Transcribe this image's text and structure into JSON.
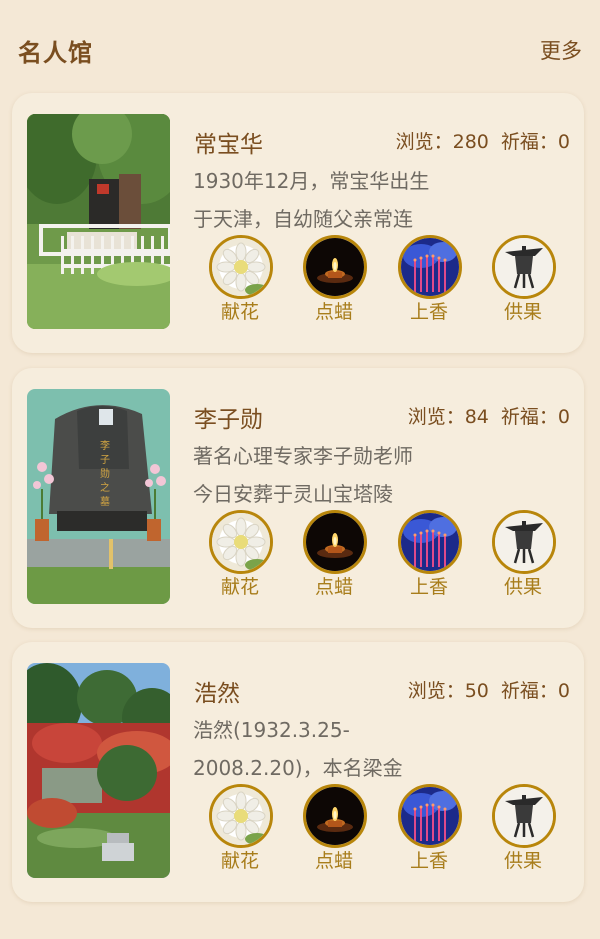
{
  "header": {
    "title": "名人馆",
    "more": "更多"
  },
  "actions": [
    {
      "label": "献花",
      "icon": "chrysanthemum-icon"
    },
    {
      "label": "点蜡",
      "icon": "candle-icon"
    },
    {
      "label": "上香",
      "icon": "incense-icon"
    },
    {
      "label": "供果",
      "icon": "bronze-vessel-icon"
    }
  ],
  "stats_labels": {
    "views": "浏览：",
    "blessings": "祈福："
  },
  "cards": [
    {
      "name": "常宝华",
      "views": "280",
      "blessings": "0",
      "line1": "1930年12月，常宝华出生",
      "line2": "于天津，自幼随父亲常连"
    },
    {
      "name": "李子勋",
      "views": "84",
      "blessings": "0",
      "line1": "著名心理专家李子勋老师",
      "line2": "今日安葬于灵山宝塔陵"
    },
    {
      "name": "浩然",
      "views": "50",
      "blessings": "0",
      "line1": "浩然(1932.3.25-",
      "line2": "2008.2.20)，本名梁金"
    }
  ],
  "colors": {
    "page_bg": "#f4e8d6",
    "card_bg": "#f6eddd",
    "brown_text": "#7a4e20",
    "gray_text": "#6f6a62",
    "gold": "#b8860b",
    "action_label": "#a87d1b"
  }
}
